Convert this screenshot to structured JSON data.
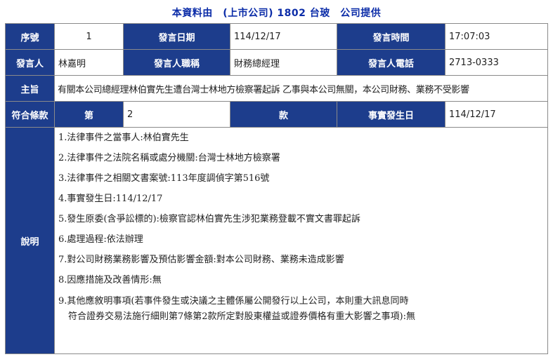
{
  "title": "本資料由　(上市公司) 1802 台玻　公司提供",
  "row1": {
    "seq_label": "序號",
    "seq_value": "1",
    "date_label": "發言日期",
    "date_value": "114/12/17",
    "time_label": "發言時間",
    "time_value": "17:07:03"
  },
  "row2": {
    "speaker_label": "發言人",
    "speaker_value": "林嘉明",
    "title_label": "發言人職稱",
    "title_value": "財務總經理",
    "phone_label": "發言人電話",
    "phone_value": "2713-0333"
  },
  "row3": {
    "subject_label": "主旨",
    "subject_value": "有關本公司總經理林伯實先生遭台灣士林地方檢察署起訴 乙事與本公司無關，本公司財務、業務不受影響"
  },
  "row4": {
    "clause_label": "符合條款",
    "article_label": "第",
    "article_value": "2",
    "item_label": "款",
    "event_date_label": "事實發生日",
    "event_date_value": "114/12/17"
  },
  "row5": {
    "desc_label": "說明",
    "lines": [
      "1.法律事件之當事人:林伯實先生",
      "2.法律事件之法院名稱或處分機關:台灣士林地方檢察署",
      "3.法律事件之相關文書案號:113年度調偵字第516號",
      "4.事實發生日:114/12/17",
      "5.發生原委(含爭訟標的):檢察官認林伯實先生涉犯業務登載不實文書罪起訴",
      "6.處理過程:依法辦理",
      "7.對公司財務業務影響及預估影響金額:對本公司財務、業務未造成影響",
      "8.因應措施及改善情形:無",
      "9.其他應敘明事項(若事件發生或決議之主體係屬公開發行以上公司，本則重大訊息同時",
      "符合證券交易法施行細則第7條第2款所定對股東權益或證券價格有重大影響之事項):無"
    ]
  }
}
